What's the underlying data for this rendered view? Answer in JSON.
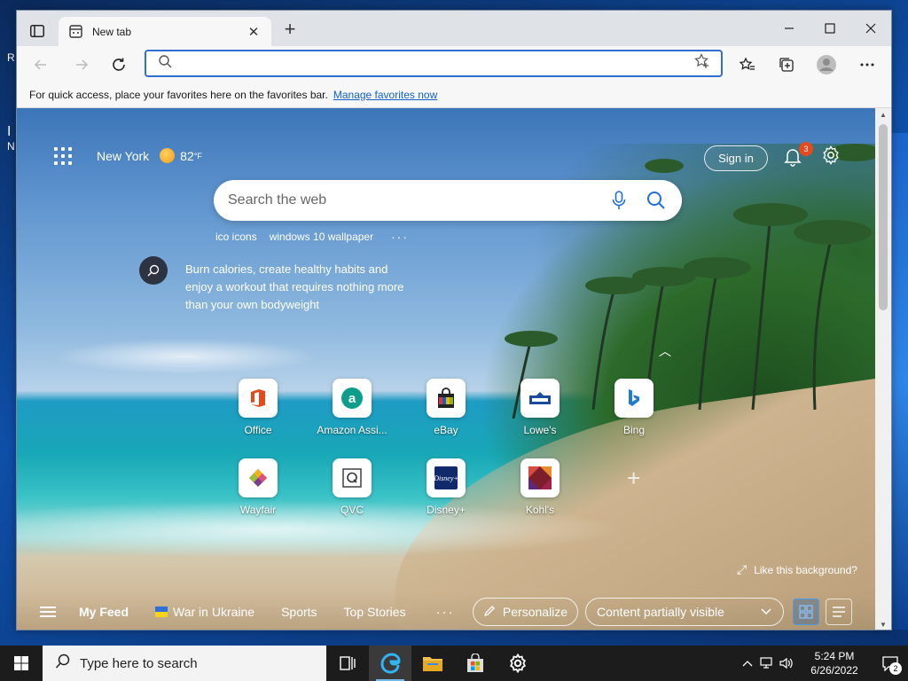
{
  "browser": {
    "tab": {
      "title": "New tab"
    },
    "address_bar": {
      "placeholder": "",
      "value": ""
    },
    "favorites_bar": {
      "message": "For quick access, place your favorites here on the favorites bar.",
      "link": "Manage favorites now"
    }
  },
  "page": {
    "weather": {
      "city": "New York",
      "temp": "82",
      "unit": "°F"
    },
    "sign_in": "Sign in",
    "notifications_count": "3",
    "search": {
      "placeholder": "Search the web"
    },
    "suggestions": [
      "ico icons",
      "windows 10 wallpaper",
      "···"
    ],
    "tip": "Burn calories, create healthy habits and enjoy a workout that requires nothing more than your own bodyweight",
    "tiles": [
      {
        "label": "Office",
        "icon": "office-icon",
        "color": "#e8492a"
      },
      {
        "label": "Amazon Assi...",
        "icon": "amazon-assistant-icon",
        "color": "#0e9d8a"
      },
      {
        "label": "eBay",
        "icon": "ebay-icon",
        "color": "#f0b33a"
      },
      {
        "label": "Lowe's",
        "icon": "lowes-icon",
        "color": "#1a4b9c"
      },
      {
        "label": "Bing",
        "icon": "bing-icon",
        "color": "#1f7ad8"
      },
      {
        "label": "Wayfair",
        "icon": "wayfair-icon",
        "color": "#7a3b8f"
      },
      {
        "label": "QVC",
        "icon": "qvc-icon",
        "color": "#333333"
      },
      {
        "label": "Disney+",
        "icon": "disney-plus-icon",
        "color": "#102a6b"
      },
      {
        "label": "Kohl's",
        "icon": "kohls-icon",
        "color": "#7c1f2a"
      }
    ],
    "like_background": "Like this background?",
    "feed": {
      "items": [
        "My Feed",
        "War in Ukraine",
        "Sports",
        "Top Stories"
      ],
      "more": "···",
      "personalize": "Personalize",
      "content_visibility": "Content partially visible"
    }
  },
  "taskbar": {
    "search_placeholder": "Type here to search",
    "time": "5:24 PM",
    "date": "6/26/2022",
    "notification_count": "2"
  }
}
